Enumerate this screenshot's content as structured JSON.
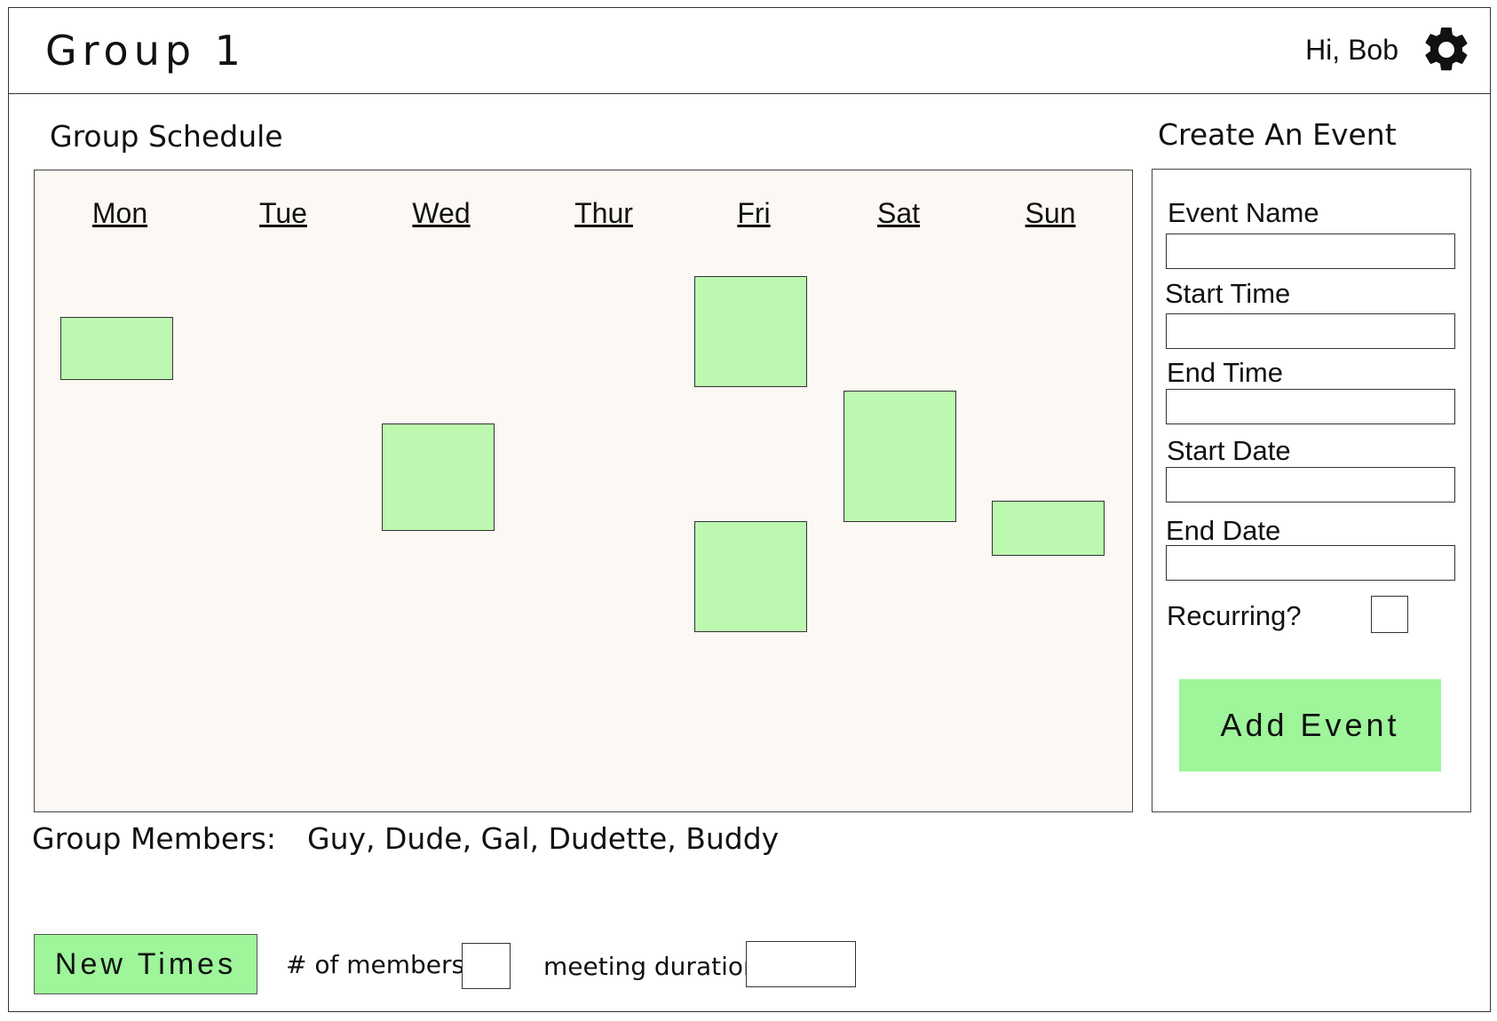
{
  "header": {
    "group_title": "Group 1",
    "greeting": "Hi, Bob",
    "settings_icon": "gear-icon"
  },
  "schedule": {
    "title": "Group Schedule",
    "days": [
      "Mon",
      "Tue",
      "Wed",
      "Thur",
      "Fri",
      "Sat",
      "Sun"
    ],
    "event_color": "#bdf8b0",
    "background_color": "#fcf8f3"
  },
  "members": {
    "label": "Group Members:",
    "list": "Guy, Dude, Gal, Dudette, Buddy"
  },
  "bottom_bar": {
    "new_times_label": "New Times",
    "members_count_label": "# of members:",
    "members_count_value": "",
    "duration_label": "meeting duration:",
    "duration_value": ""
  },
  "create_event": {
    "title": "Create An Event",
    "fields": [
      {
        "label": "Event Name",
        "value": ""
      },
      {
        "label": "Start Time",
        "value": ""
      },
      {
        "label": "End Time",
        "value": ""
      },
      {
        "label": "Start Date",
        "value": ""
      },
      {
        "label": "End Date",
        "value": ""
      }
    ],
    "recurring_label": "Recurring?",
    "recurring_checked": false,
    "add_button_label": "Add Event",
    "button_color": "#9ef59a"
  }
}
